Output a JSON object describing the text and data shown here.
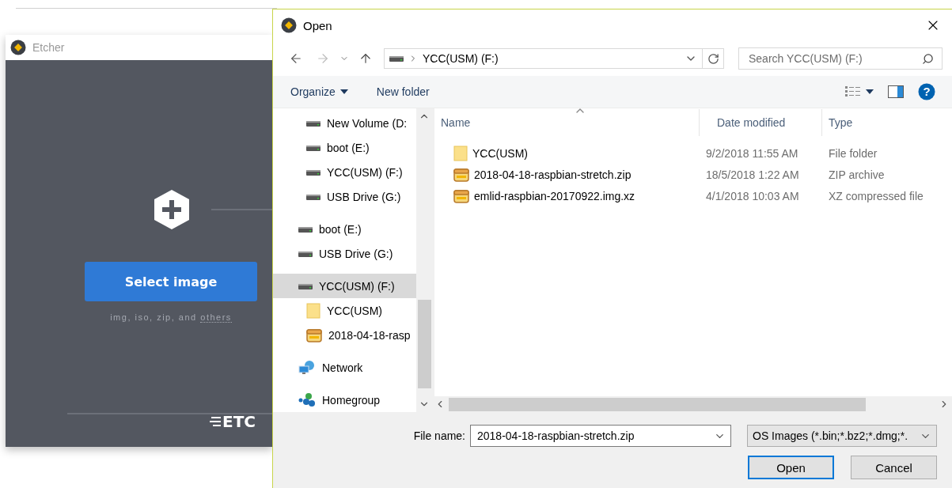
{
  "etcher": {
    "title": "Etcher",
    "select_button": "Select image",
    "hint": "img, iso, zip, and",
    "hint_link": "others",
    "logo": "ETC"
  },
  "dialog": {
    "title": "Open",
    "address": {
      "path": "YCC(USM) (F:)"
    },
    "search": {
      "placeholder": "Search YCC(USM) (F:)"
    },
    "toolbar": {
      "organize": "Organize",
      "new_folder": "New folder"
    },
    "nav_pane": {
      "drives": [
        {
          "kind": "drive",
          "label": "New Volume (D:",
          "selected": false
        },
        {
          "kind": "drive",
          "label": "boot (E:)",
          "selected": false
        },
        {
          "kind": "drive",
          "label": "YCC(USM) (F:)",
          "selected": false
        },
        {
          "kind": "drive",
          "label": "USB Drive (G:)",
          "selected": false
        }
      ],
      "items": [
        {
          "kind": "drive",
          "label": "boot (E:)",
          "selected": false
        },
        {
          "kind": "drive",
          "label": "USB Drive (G:)",
          "selected": false
        },
        {
          "kind": "drive",
          "label": "YCC(USM) (F:)",
          "selected": true,
          "children": [
            {
              "kind": "folder",
              "label": "YCC(USM)",
              "selected": false
            },
            {
              "kind": "zip",
              "label": "2018-04-18-rasp",
              "selected": false
            }
          ]
        },
        {
          "kind": "network",
          "label": "Network",
          "selected": false
        },
        {
          "kind": "homegroup",
          "label": "Homegroup",
          "selected": false
        }
      ]
    },
    "file_list": {
      "columns": [
        "Name",
        "Date modified",
        "Type"
      ],
      "rows": [
        {
          "kind": "folder",
          "name": "YCC(USM)",
          "date": "9/2/2018 11:55 AM",
          "type": "File folder"
        },
        {
          "kind": "zip",
          "name": "2018-04-18-raspbian-stretch.zip",
          "date": "18/5/2018 1:22 AM",
          "type": "ZIP archive"
        },
        {
          "kind": "zip",
          "name": "emlid-raspbian-20170922.img.xz",
          "date": "4/1/2018 10:03 AM",
          "type": "XZ compressed file"
        }
      ]
    },
    "file_name": {
      "label": "File name:",
      "value": "2018-04-18-raspbian-stretch.zip"
    },
    "filter": {
      "value": "OS Images (*.bin;*.bz2;*.dmg;*."
    },
    "buttons": {
      "open": "Open",
      "cancel": "Cancel"
    },
    "help": "?"
  }
}
